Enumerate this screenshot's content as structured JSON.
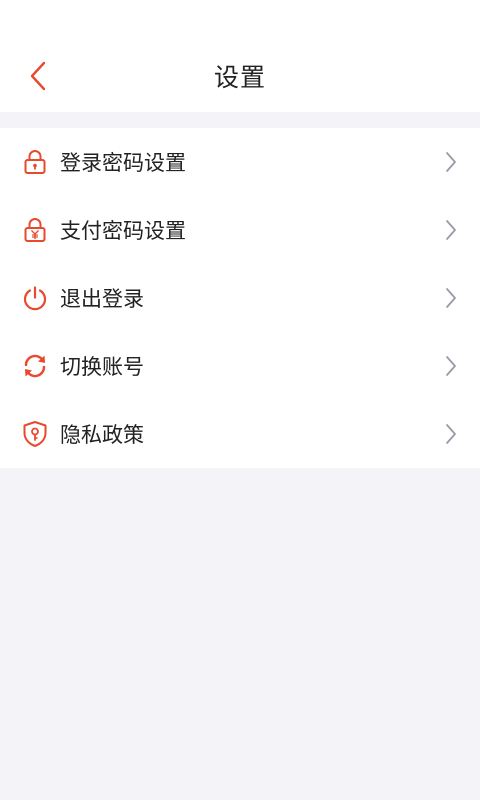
{
  "header": {
    "title": "设置",
    "back_icon": "chevron-left-icon"
  },
  "menu": {
    "items": [
      {
        "label": "登录密码设置",
        "icon": "lock-icon"
      },
      {
        "label": "支付密码设置",
        "icon": "lock-yuan-icon"
      },
      {
        "label": "退出登录",
        "icon": "power-icon"
      },
      {
        "label": "切换账号",
        "icon": "refresh-icon"
      },
      {
        "label": "隐私政策",
        "icon": "shield-icon"
      }
    ],
    "chevron_icon": "chevron-right-icon"
  },
  "colors": {
    "accent": "#e84a2e",
    "chevron": "#9a9aa6",
    "text": "#222222",
    "background": "#f4f4f8"
  }
}
